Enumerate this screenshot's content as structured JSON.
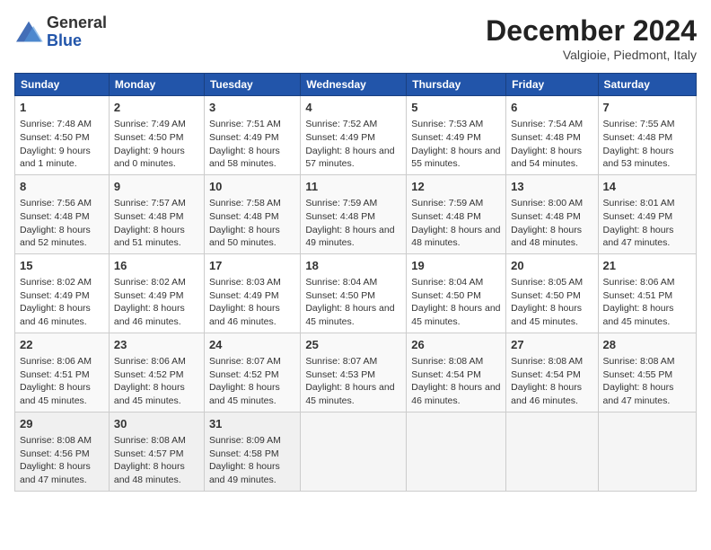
{
  "header": {
    "logo_general": "General",
    "logo_blue": "Blue",
    "month": "December 2024",
    "location": "Valgioie, Piedmont, Italy"
  },
  "days_of_week": [
    "Sunday",
    "Monday",
    "Tuesday",
    "Wednesday",
    "Thursday",
    "Friday",
    "Saturday"
  ],
  "weeks": [
    [
      {
        "day": 1,
        "sunrise": "Sunrise: 7:48 AM",
        "sunset": "Sunset: 4:50 PM",
        "daylight": "Daylight: 9 hours and 1 minute."
      },
      {
        "day": 2,
        "sunrise": "Sunrise: 7:49 AM",
        "sunset": "Sunset: 4:50 PM",
        "daylight": "Daylight: 9 hours and 0 minutes."
      },
      {
        "day": 3,
        "sunrise": "Sunrise: 7:51 AM",
        "sunset": "Sunset: 4:49 PM",
        "daylight": "Daylight: 8 hours and 58 minutes."
      },
      {
        "day": 4,
        "sunrise": "Sunrise: 7:52 AM",
        "sunset": "Sunset: 4:49 PM",
        "daylight": "Daylight: 8 hours and 57 minutes."
      },
      {
        "day": 5,
        "sunrise": "Sunrise: 7:53 AM",
        "sunset": "Sunset: 4:49 PM",
        "daylight": "Daylight: 8 hours and 55 minutes."
      },
      {
        "day": 6,
        "sunrise": "Sunrise: 7:54 AM",
        "sunset": "Sunset: 4:48 PM",
        "daylight": "Daylight: 8 hours and 54 minutes."
      },
      {
        "day": 7,
        "sunrise": "Sunrise: 7:55 AM",
        "sunset": "Sunset: 4:48 PM",
        "daylight": "Daylight: 8 hours and 53 minutes."
      }
    ],
    [
      {
        "day": 8,
        "sunrise": "Sunrise: 7:56 AM",
        "sunset": "Sunset: 4:48 PM",
        "daylight": "Daylight: 8 hours and 52 minutes."
      },
      {
        "day": 9,
        "sunrise": "Sunrise: 7:57 AM",
        "sunset": "Sunset: 4:48 PM",
        "daylight": "Daylight: 8 hours and 51 minutes."
      },
      {
        "day": 10,
        "sunrise": "Sunrise: 7:58 AM",
        "sunset": "Sunset: 4:48 PM",
        "daylight": "Daylight: 8 hours and 50 minutes."
      },
      {
        "day": 11,
        "sunrise": "Sunrise: 7:59 AM",
        "sunset": "Sunset: 4:48 PM",
        "daylight": "Daylight: 8 hours and 49 minutes."
      },
      {
        "day": 12,
        "sunrise": "Sunrise: 7:59 AM",
        "sunset": "Sunset: 4:48 PM",
        "daylight": "Daylight: 8 hours and 48 minutes."
      },
      {
        "day": 13,
        "sunrise": "Sunrise: 8:00 AM",
        "sunset": "Sunset: 4:48 PM",
        "daylight": "Daylight: 8 hours and 48 minutes."
      },
      {
        "day": 14,
        "sunrise": "Sunrise: 8:01 AM",
        "sunset": "Sunset: 4:49 PM",
        "daylight": "Daylight: 8 hours and 47 minutes."
      }
    ],
    [
      {
        "day": 15,
        "sunrise": "Sunrise: 8:02 AM",
        "sunset": "Sunset: 4:49 PM",
        "daylight": "Daylight: 8 hours and 46 minutes."
      },
      {
        "day": 16,
        "sunrise": "Sunrise: 8:02 AM",
        "sunset": "Sunset: 4:49 PM",
        "daylight": "Daylight: 8 hours and 46 minutes."
      },
      {
        "day": 17,
        "sunrise": "Sunrise: 8:03 AM",
        "sunset": "Sunset: 4:49 PM",
        "daylight": "Daylight: 8 hours and 46 minutes."
      },
      {
        "day": 18,
        "sunrise": "Sunrise: 8:04 AM",
        "sunset": "Sunset: 4:50 PM",
        "daylight": "Daylight: 8 hours and 45 minutes."
      },
      {
        "day": 19,
        "sunrise": "Sunrise: 8:04 AM",
        "sunset": "Sunset: 4:50 PM",
        "daylight": "Daylight: 8 hours and 45 minutes."
      },
      {
        "day": 20,
        "sunrise": "Sunrise: 8:05 AM",
        "sunset": "Sunset: 4:50 PM",
        "daylight": "Daylight: 8 hours and 45 minutes."
      },
      {
        "day": 21,
        "sunrise": "Sunrise: 8:06 AM",
        "sunset": "Sunset: 4:51 PM",
        "daylight": "Daylight: 8 hours and 45 minutes."
      }
    ],
    [
      {
        "day": 22,
        "sunrise": "Sunrise: 8:06 AM",
        "sunset": "Sunset: 4:51 PM",
        "daylight": "Daylight: 8 hours and 45 minutes."
      },
      {
        "day": 23,
        "sunrise": "Sunrise: 8:06 AM",
        "sunset": "Sunset: 4:52 PM",
        "daylight": "Daylight: 8 hours and 45 minutes."
      },
      {
        "day": 24,
        "sunrise": "Sunrise: 8:07 AM",
        "sunset": "Sunset: 4:52 PM",
        "daylight": "Daylight: 8 hours and 45 minutes."
      },
      {
        "day": 25,
        "sunrise": "Sunrise: 8:07 AM",
        "sunset": "Sunset: 4:53 PM",
        "daylight": "Daylight: 8 hours and 45 minutes."
      },
      {
        "day": 26,
        "sunrise": "Sunrise: 8:08 AM",
        "sunset": "Sunset: 4:54 PM",
        "daylight": "Daylight: 8 hours and 46 minutes."
      },
      {
        "day": 27,
        "sunrise": "Sunrise: 8:08 AM",
        "sunset": "Sunset: 4:54 PM",
        "daylight": "Daylight: 8 hours and 46 minutes."
      },
      {
        "day": 28,
        "sunrise": "Sunrise: 8:08 AM",
        "sunset": "Sunset: 4:55 PM",
        "daylight": "Daylight: 8 hours and 47 minutes."
      }
    ],
    [
      {
        "day": 29,
        "sunrise": "Sunrise: 8:08 AM",
        "sunset": "Sunset: 4:56 PM",
        "daylight": "Daylight: 8 hours and 47 minutes."
      },
      {
        "day": 30,
        "sunrise": "Sunrise: 8:08 AM",
        "sunset": "Sunset: 4:57 PM",
        "daylight": "Daylight: 8 hours and 48 minutes."
      },
      {
        "day": 31,
        "sunrise": "Sunrise: 8:09 AM",
        "sunset": "Sunset: 4:58 PM",
        "daylight": "Daylight: 8 hours and 49 minutes."
      },
      null,
      null,
      null,
      null
    ]
  ]
}
